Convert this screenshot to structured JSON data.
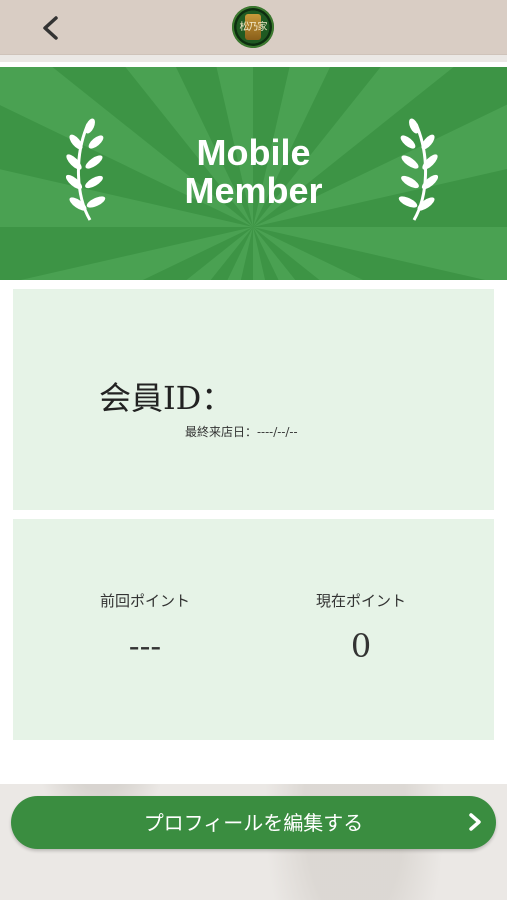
{
  "header": {
    "back_icon": "chevron-left-icon",
    "logo_text": "松乃家",
    "logo_icon": "store-logo"
  },
  "hero": {
    "title_line1": "Mobile",
    "title_line2": "Member",
    "accent_color": "#3d9445",
    "decoration_icon": "laurel-icon"
  },
  "member": {
    "id_label": "会員ID：",
    "last_visit_label": "最終来店日：----/--/--"
  },
  "points": {
    "previous_label": "前回ポイント",
    "previous_value": "---",
    "current_label": "現在ポイント",
    "current_value": "0"
  },
  "actions": {
    "edit_profile_label": "プロフィールを編集する",
    "edit_profile_icon": "chevron-right-icon"
  },
  "colors": {
    "primary_green": "#3a8d40",
    "card_bg": "#e6f3e7",
    "topbar_bg": "#d9cdc4"
  }
}
